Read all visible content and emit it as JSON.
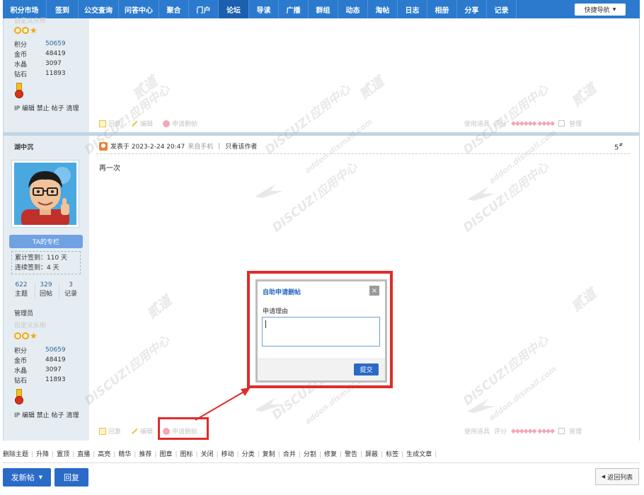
{
  "nav": {
    "items": [
      "积分市场",
      "签到",
      "公交查询",
      "问答中心",
      "聚合",
      "门户",
      "论坛",
      "导读",
      "广播",
      "群组",
      "动态",
      "淘帖",
      "日志",
      "相册",
      "分享",
      "记录"
    ],
    "active_index": 6,
    "quick_nav": "快捷导航"
  },
  "post1": {
    "custom_title": "自定义头衔",
    "stats": [
      {
        "label": "积分",
        "value": "50659"
      },
      {
        "label": "金币",
        "value": "48419"
      },
      {
        "label": "水晶",
        "value": "3097"
      },
      {
        "label": "钻石",
        "value": "11893"
      }
    ],
    "admin_links": "IP 编辑 禁止 帖子 清理",
    "actions": {
      "reply": "回复",
      "edit": "编辑",
      "delete": "申请删帖"
    },
    "tools": {
      "use_tool": "使用道具",
      "rate": "评分",
      "manage": "管理"
    }
  },
  "post2": {
    "author": "湖中沉",
    "meta": "发表于 2023-2-24 20:47",
    "source": "来自手机",
    "only_author": "只看该作者",
    "floor": "5",
    "floor_mark": "#",
    "content": "再一次",
    "column_button": "TA的专栏",
    "sign_total": "累计签到：110 天",
    "sign_streak": "连续签到：4 天",
    "counts": [
      {
        "n": "622",
        "label": "主题"
      },
      {
        "n": "329",
        "label": "回帖"
      },
      {
        "n": "3",
        "label": "记录"
      }
    ],
    "role": "管理员",
    "custom_title": "自定义头衔",
    "stats": [
      {
        "label": "积分",
        "value": "50659"
      },
      {
        "label": "金币",
        "value": "48419"
      },
      {
        "label": "水晶",
        "value": "3097"
      },
      {
        "label": "钻石",
        "value": "11893"
      }
    ],
    "admin_links": "IP 编辑 禁止 帖子 清理",
    "actions": {
      "reply": "回复",
      "edit": "编辑",
      "delete": "申请删帖"
    },
    "tools": {
      "use_tool": "使用道具",
      "rate": "评分",
      "manage": "管理"
    }
  },
  "modal": {
    "title": "自助申请删帖",
    "reason_label": "申请理由",
    "submit": "提交",
    "close": "×"
  },
  "moderation": [
    "删除主题",
    "升降",
    "置顶",
    "直播",
    "高亮",
    "精华",
    "推荐",
    "图章",
    "图标",
    "关闭",
    "移动",
    "分类",
    "复制",
    "合并",
    "分割",
    "修复",
    "警告",
    "屏蔽",
    "标签",
    "生成文章"
  ],
  "bottom": {
    "new_post": "发新帖",
    "reply": "回复",
    "back": "返回列表"
  },
  "watermark": {
    "brand": "DISCUZ!应用中心",
    "url": "addon.dismall.com",
    "cn": "贰道"
  },
  "colors": {
    "nav_bg": "#2b7acd",
    "nav_active": "#1b5fae",
    "sidebar": "#e5edf2",
    "highlight_red": "#e02b2b",
    "button_blue": "#2b6bc8"
  }
}
